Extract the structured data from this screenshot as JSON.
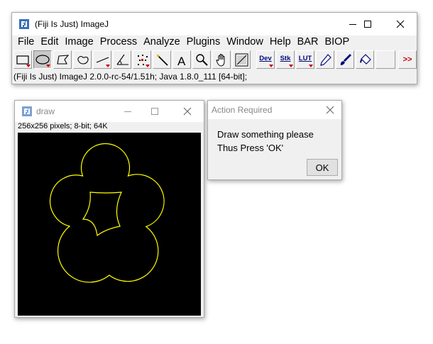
{
  "main_window": {
    "title": "(Fiji Is Just) ImageJ",
    "menus": [
      "File",
      "Edit",
      "Image",
      "Process",
      "Analyze",
      "Plugins",
      "Window",
      "Help",
      "BAR",
      "BIOP"
    ],
    "tools": [
      {
        "name": "rectangle-tool",
        "icon": "rectangle-icon"
      },
      {
        "name": "oval-tool",
        "icon": "oval-icon"
      },
      {
        "name": "polygon-tool",
        "icon": "polygon-icon"
      },
      {
        "name": "freehand-tool",
        "icon": "freehand-icon"
      },
      {
        "name": "line-tool",
        "icon": "line-icon"
      },
      {
        "name": "angle-tool",
        "icon": "angle-icon"
      },
      {
        "name": "point-tool",
        "icon": "multipoint-icon"
      },
      {
        "name": "wand-tool",
        "icon": "wand-icon"
      },
      {
        "name": "text-tool",
        "icon": "text-icon"
      },
      {
        "name": "zoom-tool",
        "icon": "magnifier-icon"
      },
      {
        "name": "hand-tool",
        "icon": "hand-icon"
      },
      {
        "name": "color-picker-tool",
        "icon": "color-picker-icon"
      },
      {
        "name": "dev-menu-tool",
        "label": "Dev"
      },
      {
        "name": "stack-menu-tool",
        "label": "Stk"
      },
      {
        "name": "lut-menu-tool",
        "label": "LUT"
      },
      {
        "name": "pencil-tool",
        "icon": "pencil-icon"
      },
      {
        "name": "brush-tool",
        "icon": "brush-icon"
      },
      {
        "name": "flood-fill-tool",
        "icon": "bucket-icon"
      },
      {
        "name": "blank-tool",
        "icon": ""
      },
      {
        "name": "more-tools-tool",
        "label": ">>"
      }
    ],
    "status": "(Fiji Is Just) ImageJ 2.0.0-rc-54/1.51h; Java 1.8.0_111 [64-bit];"
  },
  "draw_window": {
    "title": "draw",
    "info": "256x256 pixels; 8-bit; 64K"
  },
  "dialog": {
    "title": "Action Required",
    "line1": "Draw something please",
    "line2": "Thus Press 'OK'",
    "ok_label": "OK"
  },
  "colors": {
    "selection_outline": "#ffff00",
    "canvas_background": "#000000",
    "window_background": "#f0f0f0",
    "dropdown_triangle": "#c00000",
    "menu_abbr": "#00087a",
    "more_arrows": "#c00000"
  }
}
